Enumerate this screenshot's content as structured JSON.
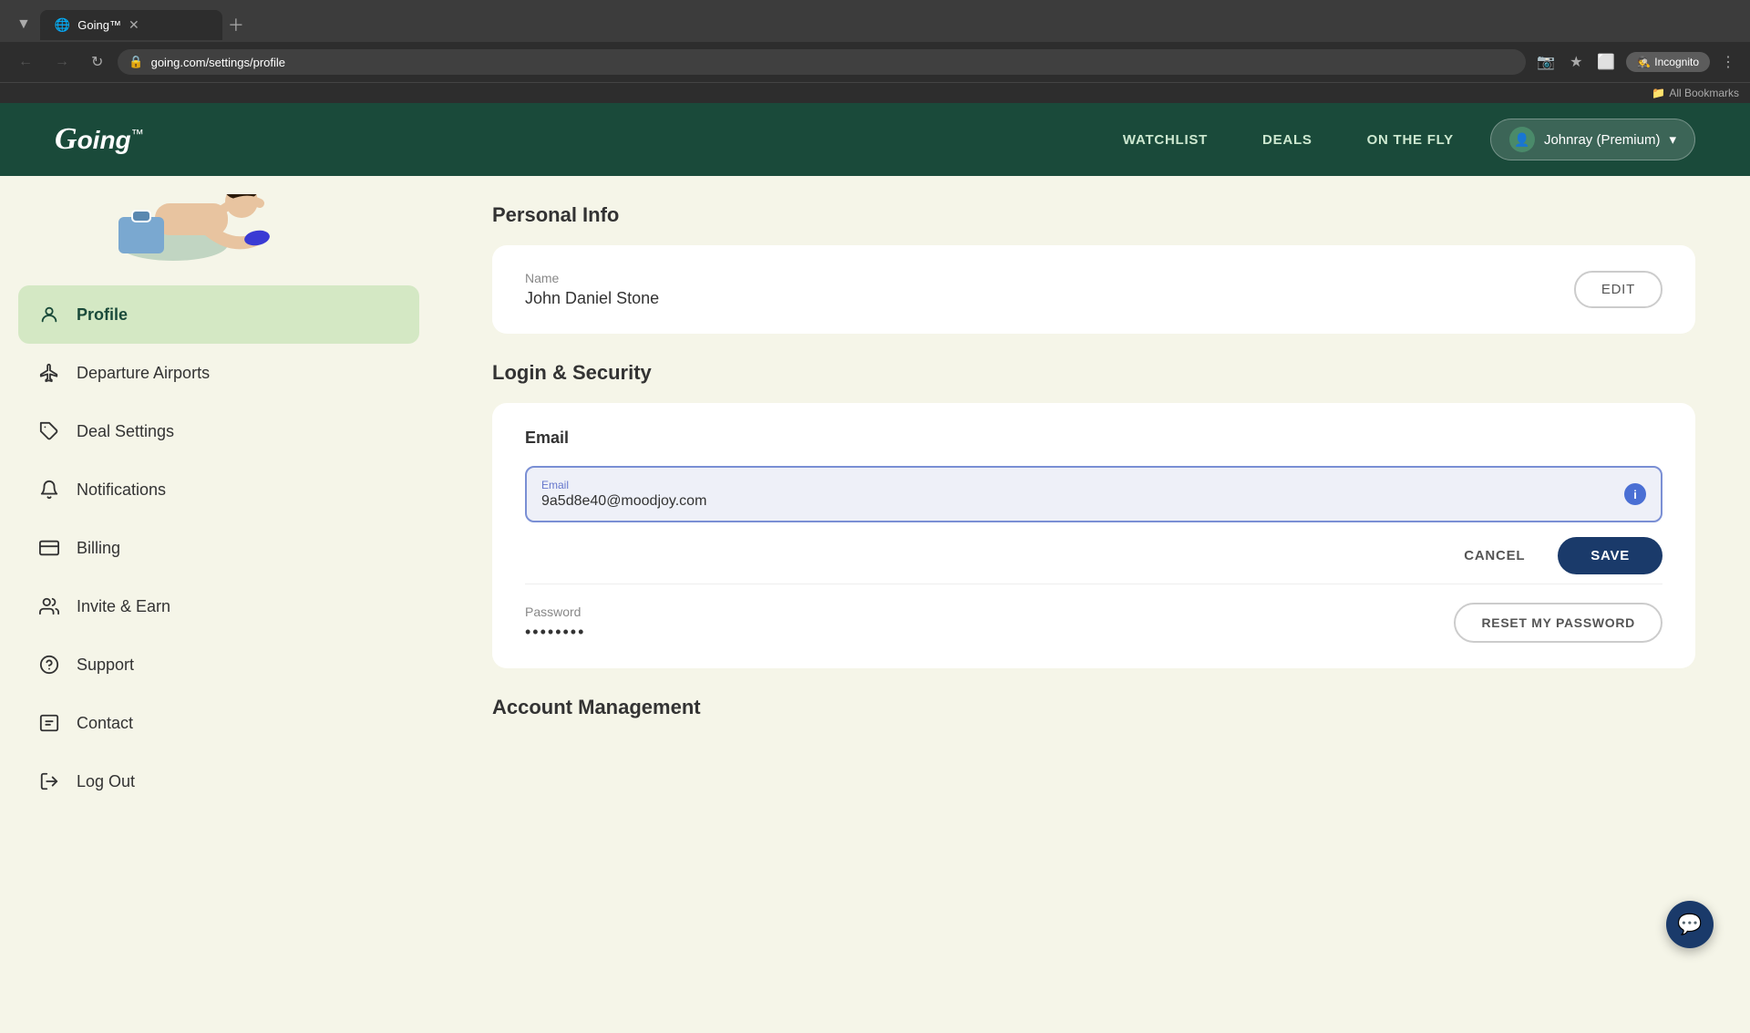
{
  "browser": {
    "tab_title": "Going™",
    "url": "going.com/settings/profile",
    "profile_btn": "Incognito",
    "bookmarks_label": "All Bookmarks"
  },
  "header": {
    "logo": "Going",
    "logo_tm": "™",
    "nav": {
      "watchlist": "WATCHLIST",
      "deals": "DEALS",
      "on_the_fly": "ON THE FLY"
    },
    "user_btn": "Johnray (Premium)"
  },
  "sidebar": {
    "items": [
      {
        "id": "profile",
        "label": "Profile",
        "active": true
      },
      {
        "id": "departure-airports",
        "label": "Departure Airports",
        "active": false
      },
      {
        "id": "deal-settings",
        "label": "Deal Settings",
        "active": false
      },
      {
        "id": "notifications",
        "label": "Notifications",
        "active": false
      },
      {
        "id": "billing",
        "label": "Billing",
        "active": false
      },
      {
        "id": "invite-earn",
        "label": "Invite & Earn",
        "active": false
      },
      {
        "id": "support",
        "label": "Support",
        "active": false
      },
      {
        "id": "contact",
        "label": "Contact",
        "active": false
      },
      {
        "id": "log-out",
        "label": "Log Out",
        "active": false
      }
    ]
  },
  "content": {
    "personal_info_title": "Personal Info",
    "name_label": "Name",
    "name_value": "John Daniel Stone",
    "edit_btn": "EDIT",
    "login_security_title": "Login & Security",
    "email_section_title": "Email",
    "email_input_label": "Email",
    "email_value": "9a5d8e40@moodjoy.com",
    "cancel_btn": "CANCEL",
    "save_btn": "SAVE",
    "password_label": "Password",
    "password_value": "••••••••",
    "reset_btn": "RESET MY PASSWORD",
    "account_mgmt_title": "Account Management"
  }
}
